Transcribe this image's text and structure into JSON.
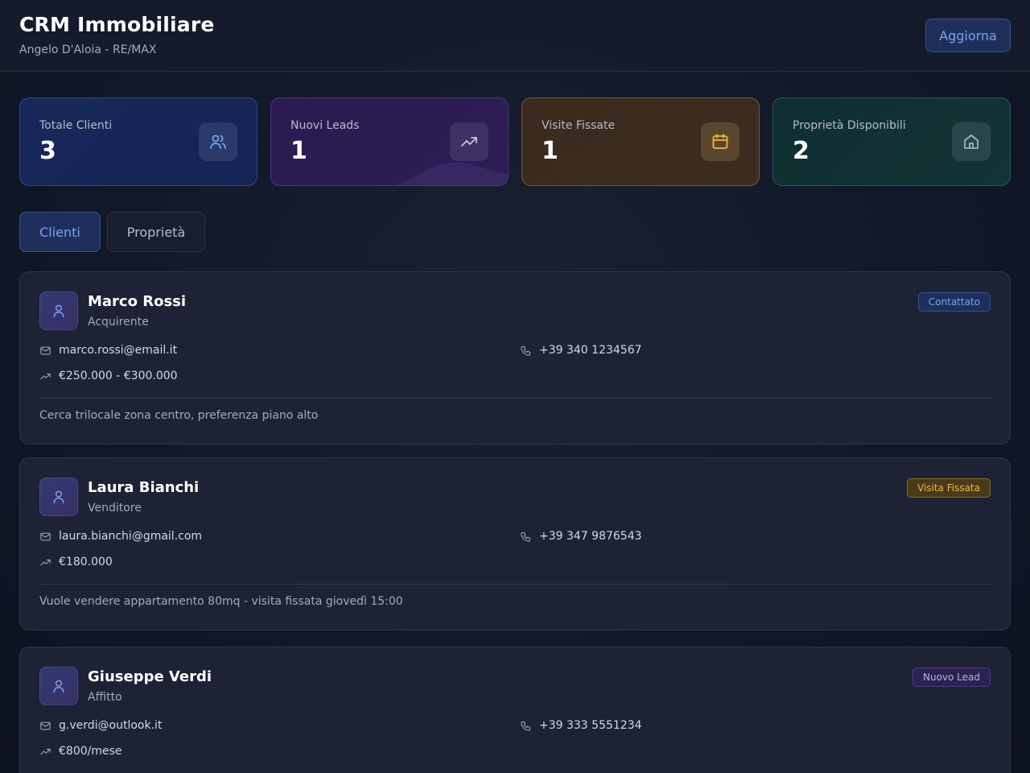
{
  "header": {
    "title": "CRM Immobiliare",
    "subtitle": "Angelo D'Aloia - RE/MAX",
    "refresh_label": "Aggiorna"
  },
  "stats": [
    {
      "label": "Totale Clienti",
      "value": "3",
      "icon": "users-icon",
      "color": "#7aa2f0"
    },
    {
      "label": "Nuovi Leads",
      "value": "1",
      "icon": "trending-up-icon",
      "color": "#c9c4dd"
    },
    {
      "label": "Visite Fissate",
      "value": "1",
      "icon": "calendar-icon",
      "color": "#f1b83a"
    },
    {
      "label": "Proprietà Disponibili",
      "value": "2",
      "icon": "home-icon",
      "color": "#9fb7b7"
    }
  ],
  "tabs": [
    {
      "label": "Clienti",
      "active": true
    },
    {
      "label": "Proprietà",
      "active": false
    }
  ],
  "clients": [
    {
      "name": "Marco Rossi",
      "type": "Acquirente",
      "status": "Contattato",
      "email": "marco.rossi@email.it",
      "phone": "+39 340 1234567",
      "budget": "€250.000 - €300.000",
      "note": "Cerca trilocale zona centro, preferenza piano alto"
    },
    {
      "name": "Laura Bianchi",
      "type": "Venditore",
      "status": "Visita Fissata",
      "email": "laura.bianchi@gmail.com",
      "phone": "+39 347 9876543",
      "budget": "€180.000",
      "note": "Vuole vendere appartamento 80mq - visita fissata giovedì 15:00"
    },
    {
      "name": "Giuseppe Verdi",
      "type": "Affitto",
      "status": "Nuovo Lead",
      "email": "g.verdi@outlook.it",
      "phone": "+39 333 5551234",
      "budget": "€800/mese"
    }
  ]
}
